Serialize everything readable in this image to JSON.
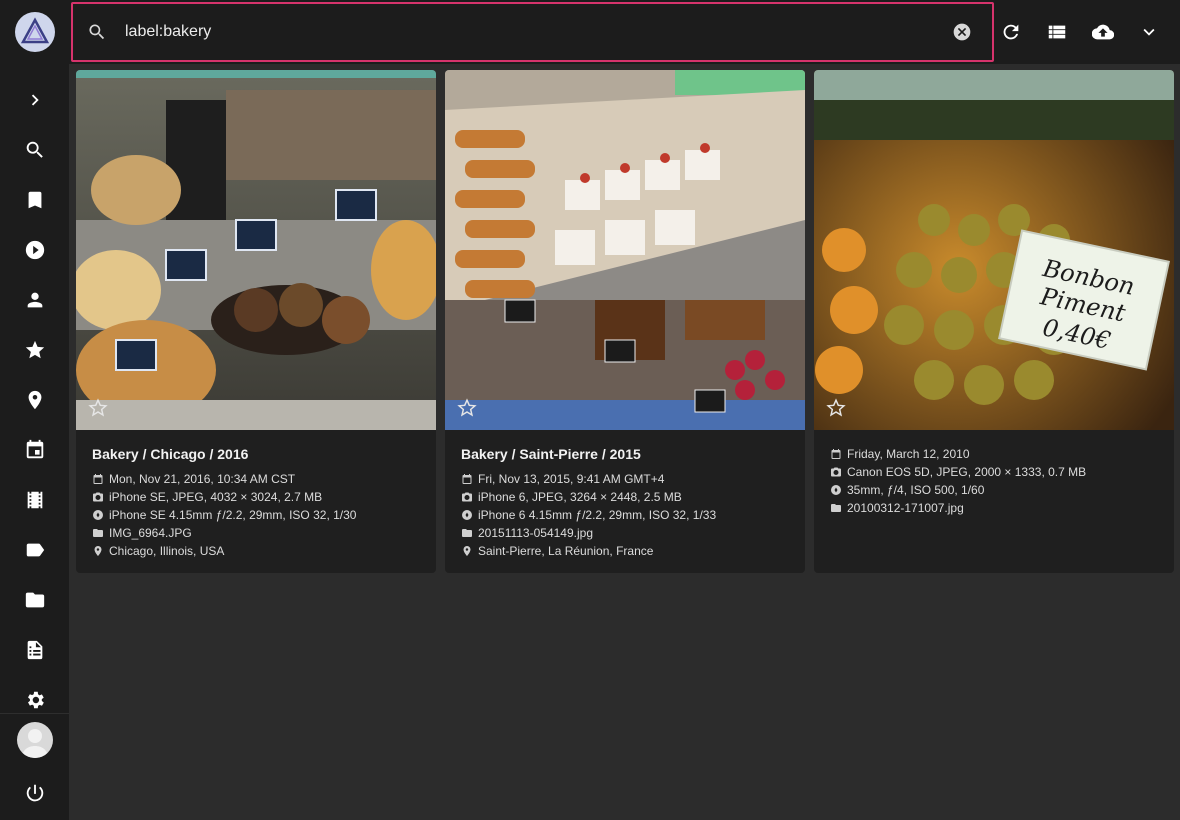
{
  "topbar": {
    "search_value": "label:bakery",
    "icons": [
      "search-icon",
      "clear-icon",
      "refresh-icon",
      "view-list-icon",
      "upload-icon",
      "chevron-down-icon"
    ]
  },
  "sidebar": {
    "icons": [
      "chevron-right-icon",
      "search-icon",
      "bookmark-icon",
      "play-icon",
      "person-icon",
      "star-icon",
      "place-icon",
      "calendar-icon",
      "film-icon",
      "label-icon",
      "folder-icon",
      "library-icon",
      "settings-icon",
      "power-icon"
    ]
  },
  "colors": {
    "accent": "#d6336c",
    "background": "#2c2c2c",
    "sidebar": "#1c1c1c",
    "card": "#1f1f1f"
  },
  "cards": [
    {
      "title": "Bakery / Chicago / 2016",
      "date": "Mon, Nov 21, 2016, 10:34 AM CST",
      "camera": "iPhone SE, JPEG, 4032 × 3024, 2.7 MB",
      "lens": "iPhone SE 4.15mm ƒ/2.2, 29mm, ISO 32, 1/30",
      "file": "IMG_6964.JPG",
      "location": "Chicago, Illinois, USA"
    },
    {
      "title": "Bakery / Saint-Pierre / 2015",
      "date": "Fri, Nov 13, 2015, 9:41 AM GMT+4",
      "camera": "iPhone 6, JPEG, 3264 × 2448, 2.5 MB",
      "lens": "iPhone 6 4.15mm ƒ/2.2, 29mm, ISO 32, 1/33",
      "file": "20151113-054149.jpg",
      "location": "Saint-Pierre, La Réunion, France"
    },
    {
      "date": "Friday, March 12, 2010",
      "camera": "Canon EOS 5D, JPEG, 2000 × 1333, 0.7 MB",
      "lens": "35mm, ƒ/4, ISO 500, 1/60",
      "file": "20100312-171007.jpg",
      "sign_text": "Bonbon Piment 0,40€"
    }
  ]
}
